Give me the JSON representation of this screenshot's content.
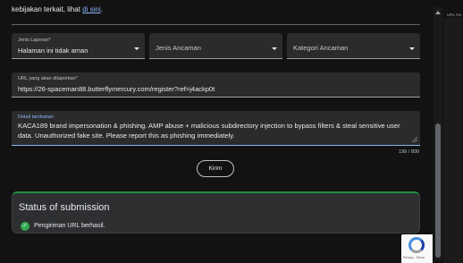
{
  "intro": {
    "text": "kebijakan terkait, lihat ",
    "link": "di sini",
    "end": "."
  },
  "form": {
    "report_type": {
      "label": "Jenis Laporan*",
      "value": "Halaman ini tidak aman"
    },
    "threat_type": {
      "placeholder": "Jenis Ancaman"
    },
    "threat_category": {
      "placeholder": "Kategori Ancaman"
    },
    "url": {
      "label": "URL yang akan dilaporkan*",
      "value": "https://26-spaceman88.butterflymercury.com/register?ref=j4ackp0t"
    },
    "details": {
      "label": "Detail tambahan",
      "value": "KACA189 brand impersonation & phishing. AMP abuse + malicious subdirectory injection to bypass filters & steal sensitive user data. Unauthorized fake site. Please report this as phishing immediately.",
      "counter": "199 / 800"
    },
    "submit_label": "Kirim"
  },
  "status": {
    "title": "Status of submission",
    "message": "Pengiriman URL berhasil."
  },
  "side": {
    "label": "URL Ha"
  },
  "captcha": {
    "links": "Privacy - Terms"
  }
}
